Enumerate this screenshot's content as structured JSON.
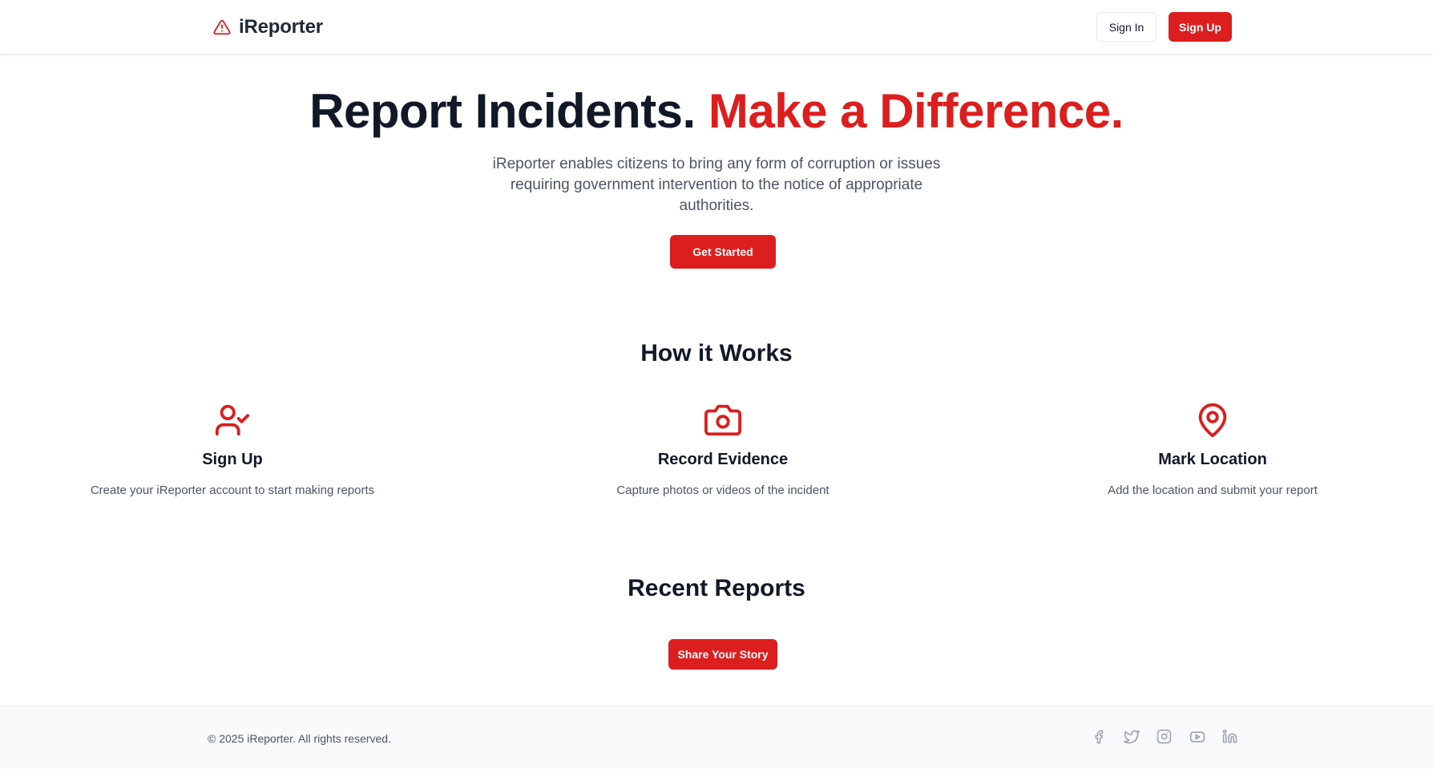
{
  "header": {
    "brand_name": "iReporter",
    "brand_icon": "alert-triangle-icon",
    "sign_in_label": "Sign In",
    "sign_up_label": "Sign Up"
  },
  "hero": {
    "title_main": "Report Incidents.",
    "title_accent": "Make a Difference.",
    "description": "iReporter enables citizens to bring any form of corruption or issues requiring government intervention to the notice of appropriate authorities.",
    "cta_label": "Get Started"
  },
  "how_it_works": {
    "title": "How it Works",
    "steps": [
      {
        "icon": "user-check-icon",
        "title": "Sign Up",
        "description": "Create your iReporter account to start making reports"
      },
      {
        "icon": "camera-icon",
        "title": "Record Evidence",
        "description": "Capture photos or videos of the incident"
      },
      {
        "icon": "map-pin-icon",
        "title": "Mark Location",
        "description": "Add the location and submit your report"
      }
    ]
  },
  "recent_reports": {
    "title": "Recent Reports",
    "cta_label": "Share Your Story"
  },
  "footer": {
    "copyright": "© 2025 iReporter. All rights reserved.",
    "socials": [
      "facebook-icon",
      "twitter-icon",
      "instagram-icon",
      "youtube-icon",
      "linkedin-icon"
    ]
  },
  "colors": {
    "accent": "#dc1e1e",
    "heading": "#111827",
    "body_text": "#4b5563",
    "footer_bg": "#f9fafb",
    "social_icon": "#9ca3af"
  }
}
